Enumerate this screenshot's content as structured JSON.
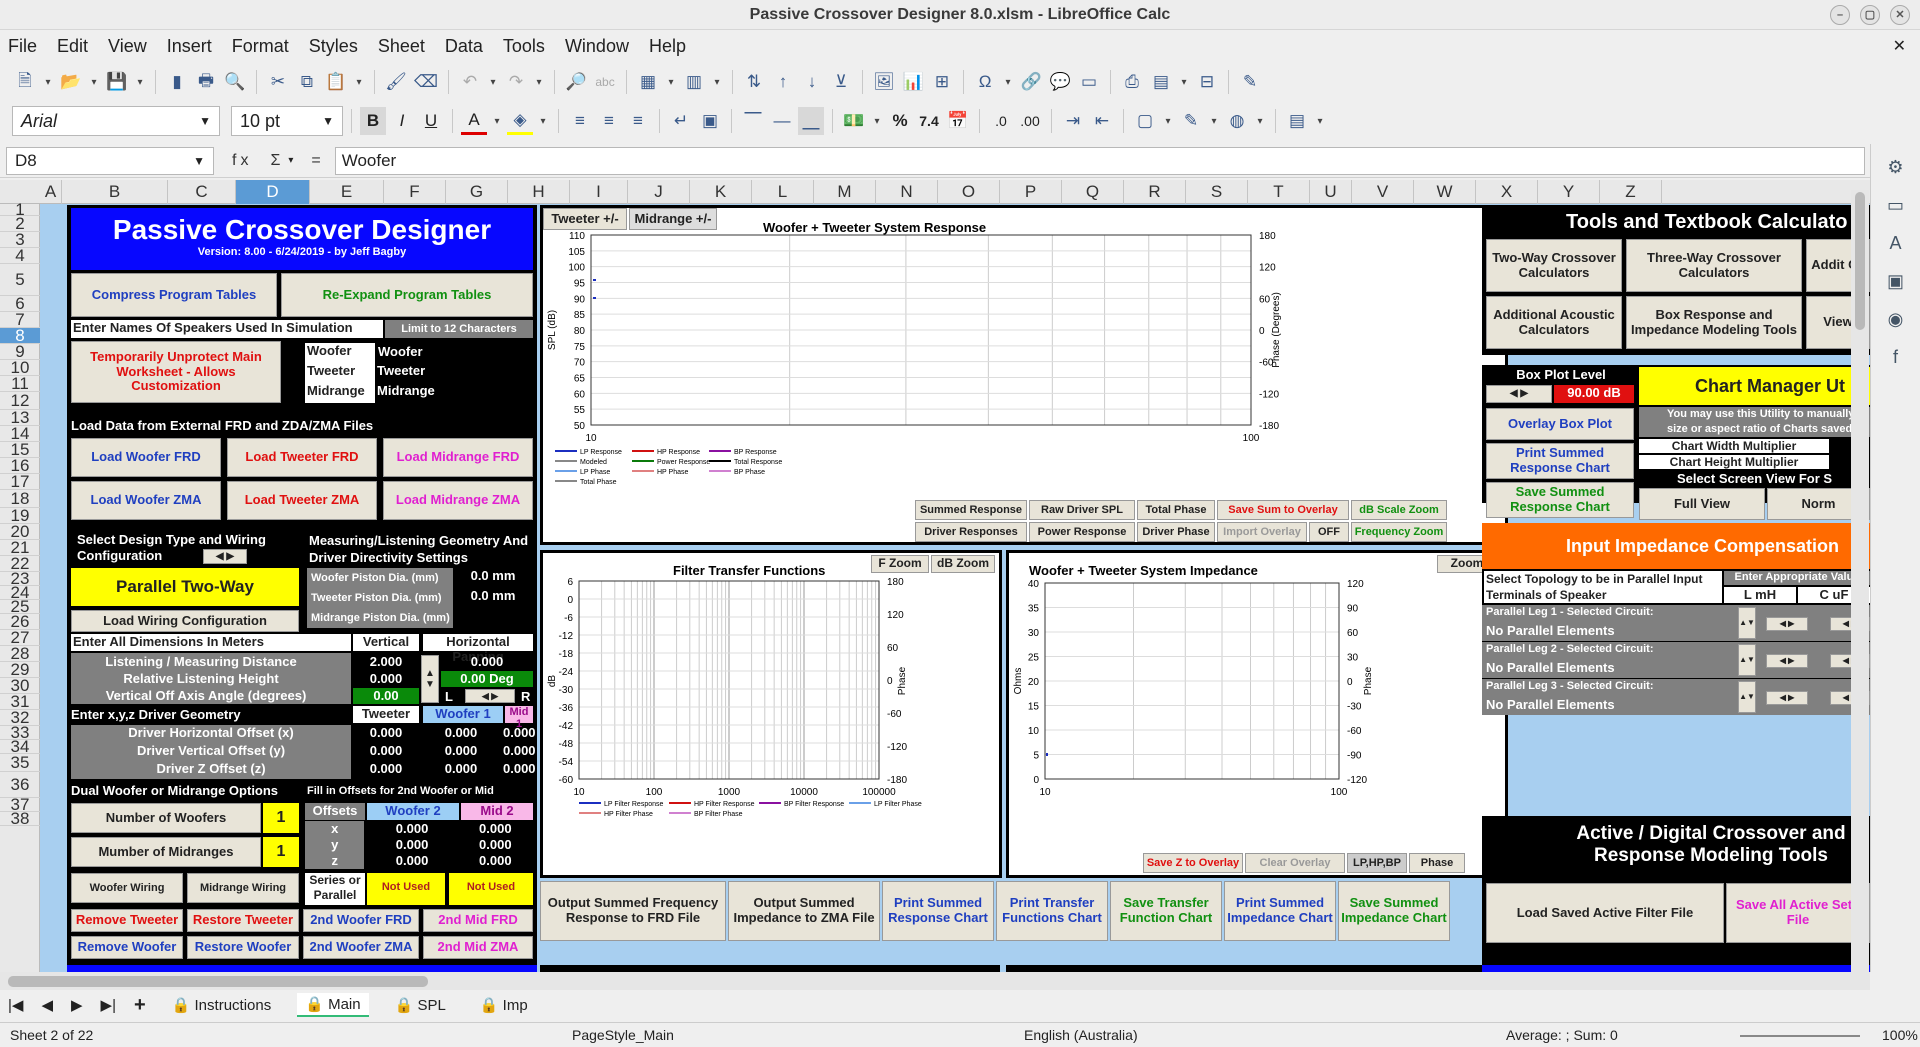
{
  "window": {
    "title": "Passive Crossover Designer 8.0.xlsm - LibreOffice Calc"
  },
  "menu": [
    "File",
    "Edit",
    "View",
    "Insert",
    "Format",
    "Styles",
    "Sheet",
    "Data",
    "Tools",
    "Window",
    "Help"
  ],
  "format_bar": {
    "font": "Arial",
    "size": "10 pt"
  },
  "formula_bar": {
    "cell_ref": "D8",
    "fx": "fx",
    "sum": "Σ",
    "eq": "=",
    "content": "Woofer"
  },
  "columns": [
    "A",
    "B",
    "C",
    "D",
    "E",
    "F",
    "G",
    "H",
    "I",
    "J",
    "K",
    "L",
    "M",
    "N",
    "O",
    "P",
    "Q",
    "R",
    "S",
    "T",
    "U",
    "V",
    "W",
    "X",
    "Y",
    "Z"
  ],
  "rows": [
    "1",
    "2",
    "3",
    "4",
    "5",
    "6",
    "7",
    "8",
    "9",
    "10",
    "11",
    "12",
    "13",
    "14",
    "15",
    "16",
    "17",
    "18",
    "19",
    "20",
    "21",
    "22",
    "23",
    "24",
    "25",
    "26",
    "27",
    "28",
    "29",
    "30",
    "31",
    "32",
    "33",
    "34",
    "35",
    "36",
    "37",
    "38"
  ],
  "left": {
    "title": "Passive Crossover Designer",
    "version": "Version: 8.00  -  6/24/2019 - by Jeff Bagby",
    "compress": "Compress Program Tables",
    "reexpand": "Re-Expand Program Tables",
    "enter_names": "Enter Names Of Speakers Used In Simulation",
    "limit": "Limit to 12 Characters",
    "unprotect": "Temporarily Unprotect Main Worksheet - Allows Customization",
    "names": [
      [
        "Woofer",
        "Woofer"
      ],
      [
        "Tweeter",
        "Tweeter"
      ],
      [
        "Midrange",
        "Midrange"
      ]
    ],
    "load_data": "Load Data from External FRD and ZDA/ZMA Files",
    "load_btns": [
      "Load Woofer FRD",
      "Load Tweeter FRD",
      "Load Midrange FRD",
      "Load Woofer ZMA",
      "Load Tweeter ZMA",
      "Load Midrange ZMA"
    ],
    "select_design": "Select Design Type and Wiring Configuration",
    "design": "Parallel Two-Way",
    "load_wiring": "Load Wiring Configuration",
    "geom_title": "Measuring/Listening Geometry And Driver Directivity Settings",
    "piston": [
      [
        "Woofer Piston Dia. (mm)",
        "0.0 mm"
      ],
      [
        "Tweeter Piston Dia. (mm)",
        "0.0 mm"
      ],
      [
        "Midrange Piston Dia. (mm)",
        ""
      ]
    ],
    "dims": "Enter All Dimensions In Meters",
    "vertical": "Vertical",
    "hpan": "Horizontal Panning",
    "dist_lbl": "Listening / Measuring  Distance",
    "dist_v": "2.000",
    "dist_h": "0.000",
    "height_lbl": "Relative Listening Height",
    "height_v": "0.000",
    "deg": "0.00 Deg",
    "offaxis_lbl": "Vertical Off Axis Angle (degrees)",
    "offaxis_v": "0.00",
    "L": "L",
    "R": "R",
    "xyz": "Enter x,y,z Driver Geometry",
    "hdr": [
      "Tweeter",
      "Woofer 1",
      "Mid 1"
    ],
    "offs": [
      [
        "Driver Horizontal Offset (x)",
        "0.000",
        "0.000",
        "0.000"
      ],
      [
        "Driver Vertical Offset (y)",
        "0.000",
        "0.000",
        "0.000"
      ],
      [
        "Driver Z Offset (z)",
        "0.000",
        "0.000",
        "0.000"
      ]
    ],
    "dual": "Dual Woofer or Midrange Options",
    "fill": "Fill in Offsets for 2nd Woofer or Mid",
    "nwoof": "Number of Woofers",
    "nwoof_v": "1",
    "nmid": "Mumber of Midranges",
    "nmid_v": "1",
    "off_hdr": [
      "Offsets",
      "Woofer 2",
      "Mid 2"
    ],
    "off2": [
      [
        "x",
        "0.000",
        "0.000"
      ],
      [
        "y",
        "0.000",
        "0.000"
      ],
      [
        "z",
        "0.000",
        "0.000"
      ]
    ],
    "woofer_wiring": "Woofer Wiring",
    "mid_wiring": "Midrange Wiring",
    "series": "Series or Parallel",
    "not_used": "Not Used",
    "bottom": [
      "Remove Tweeter",
      "Restore Tweeter",
      "2nd Woofer FRD",
      "2nd Mid FRD",
      "Remove Woofer",
      "Restore Woofer",
      "2nd Woofer ZMA",
      "2nd Mid ZMA"
    ]
  },
  "resp_chart": {
    "tabs": [
      "Tweeter +/-",
      "Midrange  +/-"
    ],
    "title": "Woofer + Tweeter    System Response",
    "yl": "SPL (dB)",
    "yr": "Phase (Degrees)",
    "yticks": [
      "110",
      "105",
      "100",
      "95",
      "90",
      "85",
      "80",
      "75",
      "70",
      "65",
      "60",
      "55",
      "50"
    ],
    "rticks": [
      "180",
      "120",
      "60",
      "0",
      "-60",
      "-120",
      "-180"
    ],
    "xticks": [
      "10",
      "100"
    ],
    "legend": [
      [
        "LP Response",
        "#1b2ec0"
      ],
      [
        "HP Response",
        "#d01010"
      ],
      [
        "BP Response",
        "#8a10a0"
      ],
      [
        "Modeled",
        "#888"
      ],
      [
        "Power Response",
        "#0a7a0a"
      ],
      [
        "Total Response",
        "#000"
      ],
      [
        "LP Phase",
        "#6aa0e8"
      ],
      [
        "HP Phase",
        "#e08080"
      ],
      [
        "BP Phase",
        "#d080d0"
      ],
      [
        "Total Phase",
        "#888"
      ]
    ],
    "btns": [
      "Summed Response",
      "Raw Driver SPL",
      "Total Phase",
      "Save Sum to Overlay",
      "dB Scale Zoom",
      "Driver Responses",
      "Power Response",
      "Driver Phase",
      "Import Overlay",
      "OFF",
      "Frequency Zoom"
    ]
  },
  "filter_chart": {
    "title": "Filter Transfer Functions",
    "fzoom": "F Zoom",
    "dbzoom": "dB Zoom",
    "yl": "dB",
    "yr": "Phase",
    "yticks": [
      "6",
      "0",
      "-6",
      "-12",
      "-18",
      "-24",
      "-30",
      "-36",
      "-42",
      "-48",
      "-54",
      "-60"
    ],
    "rticks": [
      "180",
      "120",
      "60",
      "0",
      "-60",
      "-120",
      "-180"
    ],
    "xticks": [
      "10",
      "100",
      "1000",
      "10000",
      "100000"
    ],
    "legend": [
      "LP Filter Response",
      "HP Filter Response",
      "BP Filter Response",
      "LP Filter Phase",
      "HP Filter Phase",
      "BP Filter Phase"
    ]
  },
  "imp_chart": {
    "title": "Woofer + Tweeter    System Impedance",
    "zoom": "Zoom",
    "yl": "Ohms",
    "yr": "Phase",
    "yticks": [
      "40",
      "35",
      "30",
      "25",
      "20",
      "15",
      "10",
      "5",
      "0"
    ],
    "rticks": [
      "120",
      "90",
      "60",
      "30",
      "0",
      "-30",
      "-60",
      "-90",
      "-120"
    ],
    "xticks": [
      "10",
      "100"
    ],
    "btns": [
      "Save Z to Overlay",
      "Clear Overlay",
      "LP,HP,BP",
      "Phase"
    ]
  },
  "bottom_btns": [
    "Output Summed Frequency Response to FRD File",
    "Output Summed Impedance to ZMA File",
    "Print Summed Response Chart",
    "Print Transfer Functions Chart",
    "Save Transfer Function Chart",
    "Print Summed Impedance Chart",
    "Save Summed Impedance Chart"
  ],
  "right": {
    "tools": "Tools and Textbook Calculato",
    "tool_btns": [
      "Two-Way Crossover Calculators",
      "Three-Way Crossover Calculators",
      "Addit Ca",
      "Additional Acoustic Calculators",
      "Box Response and Impedance Modeling Tools",
      "View"
    ],
    "box_plot": "Box Plot Level",
    "box_val": "90.00 dB",
    "chart_mgr": "Chart Manager Ut",
    "mgr_text": "You may use this Utility to manually size or aspect ratio of Charts saved",
    "overlay": "Overlay Box Plot",
    "print_sum": "Print Summed Response Chart",
    "save_sum": "Save Summed Response Chart",
    "cw": "Chart Width Multiplier",
    "ch": "Chart Height Multiplier",
    "screen": "Select Screen View For S",
    "full": "Full View",
    "norm": "Norm",
    "iic": "Input Impedance Compensation",
    "topo": "Select Topology to be in Parallel Input Terminals of Speaker",
    "enter_vals": "Enter Appropriate Value",
    "lmh": "L mH",
    "cuf": "C uF",
    "legs": [
      [
        "Parallel Leg 1 - Selected Circuit:",
        "No Parallel Elements"
      ],
      [
        "Parallel Leg 2 - Selected Circuit:",
        "No Parallel Elements"
      ],
      [
        "Parallel Leg 3 - Selected Circuit:",
        "No Parallel Elements"
      ]
    ],
    "active": "Active / Digital Crossover and Response Modeling Tools",
    "load_active": "Load Saved Active Filter File",
    "save_active": "Save All Active Setti File"
  },
  "sheet_tabs": [
    "Instructions",
    "Main",
    "SPL",
    "Imp"
  ],
  "status": {
    "sheet": "Sheet 2 of 22",
    "style": "PageStyle_Main",
    "lang": "English (Australia)",
    "calc": "Average: ; Sum: 0",
    "zoom": "100%"
  }
}
